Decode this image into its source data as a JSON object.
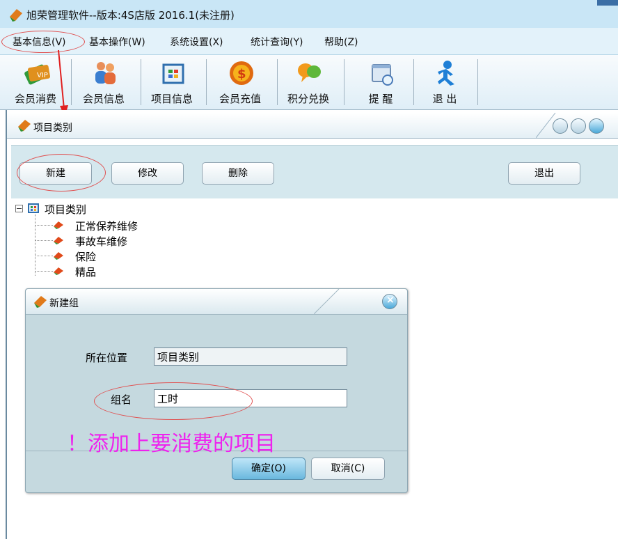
{
  "window": {
    "title": "旭荣管理软件--版本:4S店版 2016.1(未注册)"
  },
  "menu": {
    "items": [
      "基本信息(V)",
      "基本操作(W)",
      "系统设置(X)",
      "统计查询(Y)",
      "帮助(Z)"
    ]
  },
  "toolbar": {
    "items": [
      {
        "label": "会员消费",
        "icon": "vip-card-icon"
      },
      {
        "label": "会员信息",
        "icon": "users-icon"
      },
      {
        "label": "项目信息",
        "icon": "grid-window-icon"
      },
      {
        "label": "会员充值",
        "icon": "dollar-coin-icon"
      },
      {
        "label": "积分兑换",
        "icon": "chat-bubbles-icon"
      },
      {
        "label": "提 醒",
        "icon": "reminder-window-icon"
      },
      {
        "label": "退 出",
        "icon": "exit-person-icon"
      }
    ]
  },
  "doc_window": {
    "title": "项目类别",
    "buttons": {
      "new": "新建",
      "edit": "修改",
      "delete": "删除",
      "exit": "退出"
    }
  },
  "tree": {
    "root": "项目类别",
    "children": [
      "正常保养维修",
      "事故车维修",
      "保险",
      "精品"
    ]
  },
  "dialog": {
    "title": "新建组",
    "location_label": "所在位置",
    "location_value": "项目类别",
    "name_label": "组名",
    "name_value": "工时",
    "ok_label": "确定(O)",
    "cancel_label": "取消(C)"
  },
  "annotation": {
    "text": "！添加上要消费的项目"
  },
  "colors": {
    "annotation": "#ee22ee",
    "highlight_ellipse": "#e05050",
    "arrow": "#e02020",
    "panel": "#d5e8ee"
  }
}
